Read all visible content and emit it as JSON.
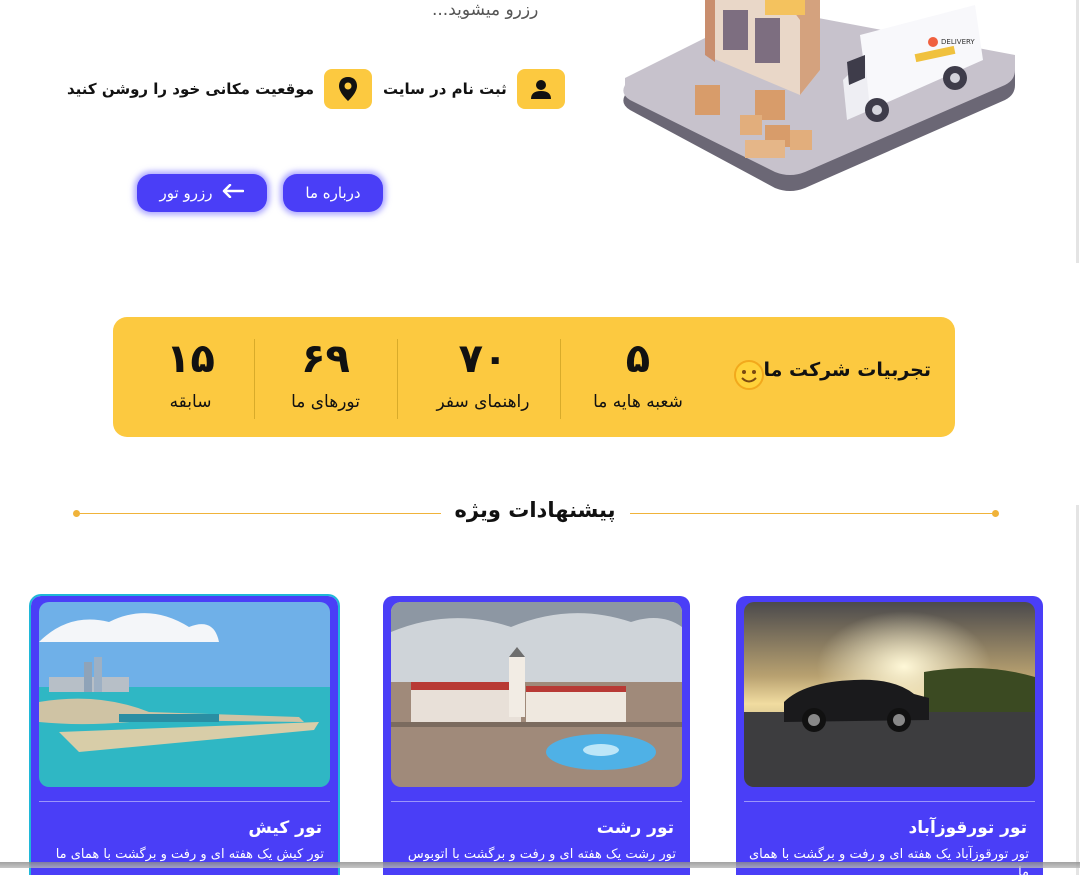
{
  "hero": {
    "tagline": "رزرو میشوید...",
    "features": [
      {
        "label": "ثبت نام در سایت",
        "icon": "user-icon"
      },
      {
        "label": "موقعیت مکانی خود را روشن کنید",
        "icon": "location-pin-icon"
      }
    ],
    "buttons": {
      "about": "درباره ما",
      "book": "رزرو تور"
    },
    "van_label": "DELIVERY"
  },
  "stats": {
    "title": "تجربیات شرکت ما",
    "items": [
      {
        "value": "۵",
        "label": "شعبه هایه ما"
      },
      {
        "value": "۷۰",
        "label": "راهنمای سفر"
      },
      {
        "value": "۶۹",
        "label": "تورهای ما"
      },
      {
        "value": "۱۵",
        "label": "سابقه"
      }
    ]
  },
  "offers": {
    "title": "پیشنهادات ویژه",
    "cards": [
      {
        "title": "تور تورقوزآباد",
        "desc": "تور تورقوزآباد یک هفته ای و رفت و برگشت با همای ما"
      },
      {
        "title": "تور رشت",
        "desc": "تور رشت یک هفته ای و رفت و برگشت با اتوبوس"
      },
      {
        "title": "تور کیش",
        "desc": "تور کیش یک هفته ای و رفت و برگشت با همای ما"
      }
    ]
  },
  "colors": {
    "accent": "#4a3ef7",
    "yellow": "#fcc940",
    "line": "#f0b33a"
  }
}
